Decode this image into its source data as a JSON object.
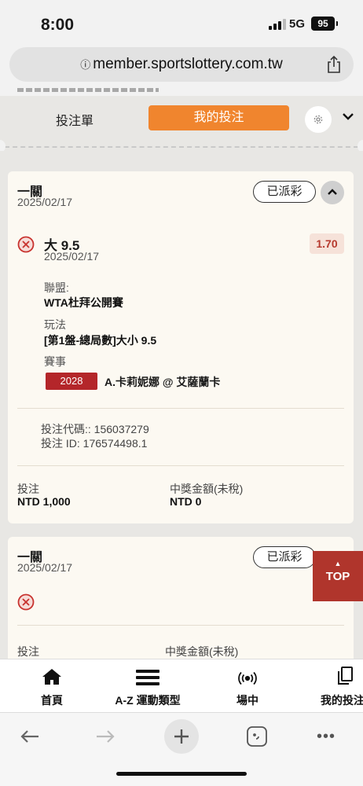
{
  "status": {
    "time": "8:00",
    "network": "5G",
    "battery": "95"
  },
  "browser": {
    "url": "member.sportslottery.com.tw"
  },
  "tabs": {
    "betslip_label": "投注單",
    "mybets_label": "我的投注"
  },
  "bets": [
    {
      "type": "一關",
      "date": "2025/02/17",
      "status": "已派彩",
      "selection": {
        "name": "大 9.5",
        "date": "2025/02/17",
        "odds": "1.70",
        "league_label": "聯盟:",
        "league": "WTA杜拜公開賽",
        "market_label": "玩法",
        "market": "[第1盤-總局數]大小 9.5",
        "event_label": "賽事",
        "event_id": "2028",
        "event": "A.卡莉妮娜 @ 艾薩蘭卡"
      },
      "bet_code": "投注代碼:: 156037279",
      "bet_id": "投注 ID: 176574498.1",
      "stake_label": "投注",
      "stake": "NTD 1,000",
      "payout_label": "中獎金額(未稅)",
      "payout": "NTD 0"
    },
    {
      "type": "一關",
      "date": "2025/02/17",
      "status": "已派彩",
      "stake_label": "投注",
      "payout_label": "中獎金額(未稅)"
    }
  ],
  "top_button": "TOP",
  "bottom_nav": [
    {
      "label": "首頁",
      "icon": "home-icon"
    },
    {
      "label": "A-Z 運動類型",
      "icon": "menu-icon"
    },
    {
      "label": "場中",
      "icon": "live-icon"
    },
    {
      "label": "我的投注",
      "icon": "copy-icon"
    }
  ],
  "colors": {
    "accent": "#f0852e",
    "badge_red": "#b4262a",
    "lose_red": "#c8322e",
    "top_button": "#b0352c"
  }
}
